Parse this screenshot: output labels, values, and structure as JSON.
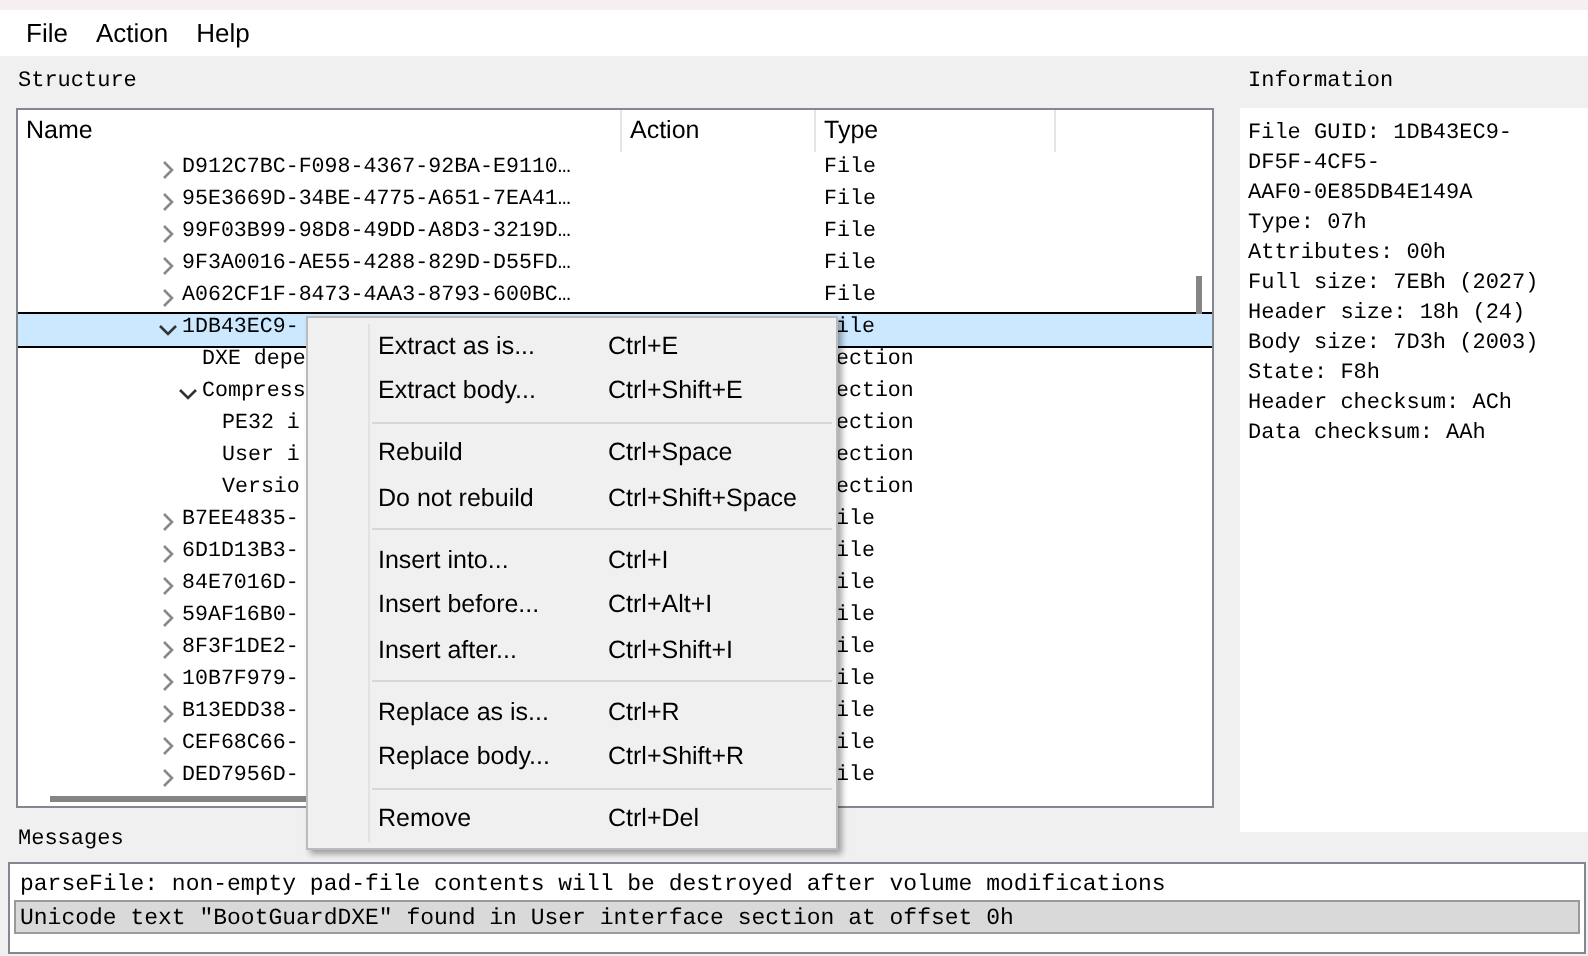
{
  "menu_bar": [
    "File",
    "Action",
    "Help"
  ],
  "structure": {
    "title": "Structure",
    "columns": [
      "Name",
      "Action",
      "Type"
    ],
    "rows": [
      {
        "name": "D912C7BC-F098-4367-92BA-E9110…",
        "type": "File",
        "expanded": false,
        "selected": false
      },
      {
        "name": "95E3669D-34BE-4775-A651-7EA41…",
        "type": "File",
        "expanded": false,
        "selected": false
      },
      {
        "name": "99F03B99-98D8-49DD-A8D3-3219D…",
        "type": "File",
        "expanded": false,
        "selected": false
      },
      {
        "name": "9F3A0016-AE55-4288-829D-D55FD…",
        "type": "File",
        "expanded": false,
        "selected": false
      },
      {
        "name": "A062CF1F-8473-4AA3-8793-600BC…",
        "type": "File",
        "expanded": false,
        "selected": false
      },
      {
        "name": "1DB43EC9-",
        "type": "ile",
        "expanded": true,
        "selected": true,
        "children": [
          {
            "name": "DXE depe",
            "type": "ection",
            "selected": false
          },
          {
            "name": "Compress",
            "type": "ection",
            "expanded": true,
            "selected": false,
            "children": [
              {
                "name": "PE32 i",
                "type": "ection",
                "selected": false
              },
              {
                "name": "User i",
                "type": "ection",
                "selected": false
              },
              {
                "name": "Versio",
                "type": "ection",
                "selected": false
              }
            ]
          }
        ]
      },
      {
        "name": "B7EE4835-",
        "type": "ile",
        "expanded": false,
        "selected": false
      },
      {
        "name": "6D1D13B3-",
        "type": "ile",
        "expanded": false,
        "selected": false
      },
      {
        "name": "84E7016D-",
        "type": "ile",
        "expanded": false,
        "selected": false
      },
      {
        "name": "59AF16B0-",
        "type": "ile",
        "expanded": false,
        "selected": false
      },
      {
        "name": "8F3F1DE2-",
        "type": "ile",
        "expanded": false,
        "selected": false
      },
      {
        "name": "10B7F979-",
        "type": "ile",
        "expanded": false,
        "selected": false
      },
      {
        "name": "B13EDD38-",
        "type": "ile",
        "expanded": false,
        "selected": false
      },
      {
        "name": "CEF68C66-",
        "type": "ile",
        "expanded": false,
        "selected": false
      },
      {
        "name": "DED7956D-",
        "type": "ile",
        "expanded": false,
        "selected": false
      }
    ]
  },
  "context_menu": [
    {
      "kind": "item",
      "label": "Extract as is...",
      "shortcut": "Ctrl+E"
    },
    {
      "kind": "item",
      "label": "Extract body...",
      "shortcut": "Ctrl+Shift+E"
    },
    {
      "kind": "separator"
    },
    {
      "kind": "item",
      "label": "Rebuild",
      "shortcut": "Ctrl+Space"
    },
    {
      "kind": "item",
      "label": "Do not rebuild",
      "shortcut": "Ctrl+Shift+Space"
    },
    {
      "kind": "separator"
    },
    {
      "kind": "item",
      "label": "Insert into...",
      "shortcut": "Ctrl+I"
    },
    {
      "kind": "item",
      "label": "Insert before...",
      "shortcut": "Ctrl+Alt+I"
    },
    {
      "kind": "item",
      "label": "Insert after...",
      "shortcut": "Ctrl+Shift+I"
    },
    {
      "kind": "separator"
    },
    {
      "kind": "item",
      "label": "Replace as is...",
      "shortcut": "Ctrl+R"
    },
    {
      "kind": "item",
      "label": "Replace body...",
      "shortcut": "Ctrl+Shift+R"
    },
    {
      "kind": "separator"
    },
    {
      "kind": "item",
      "label": "Remove",
      "shortcut": "Ctrl+Del"
    }
  ],
  "information": {
    "title": "Information",
    "lines": [
      "File GUID: 1DB43EC9-",
      "DF5F-4CF5-",
      "AAF0-0E85DB4E149A",
      "Type: 07h",
      "Attributes: 00h",
      "Full size: 7EBh (2027)",
      "Header size: 18h (24)",
      "Body size: 7D3h (2003)",
      "State: F8h",
      "Header checksum: ACh",
      "Data checksum: AAh"
    ]
  },
  "messages": {
    "title": "Messages",
    "items": [
      {
        "text": "parseFile: non-empty pad-file contents will be destroyed after volume modifications",
        "selected": false
      },
      {
        "text": "Unicode text \"BootGuardDXE\" found in User interface section at offset 0h",
        "selected": true
      }
    ]
  }
}
